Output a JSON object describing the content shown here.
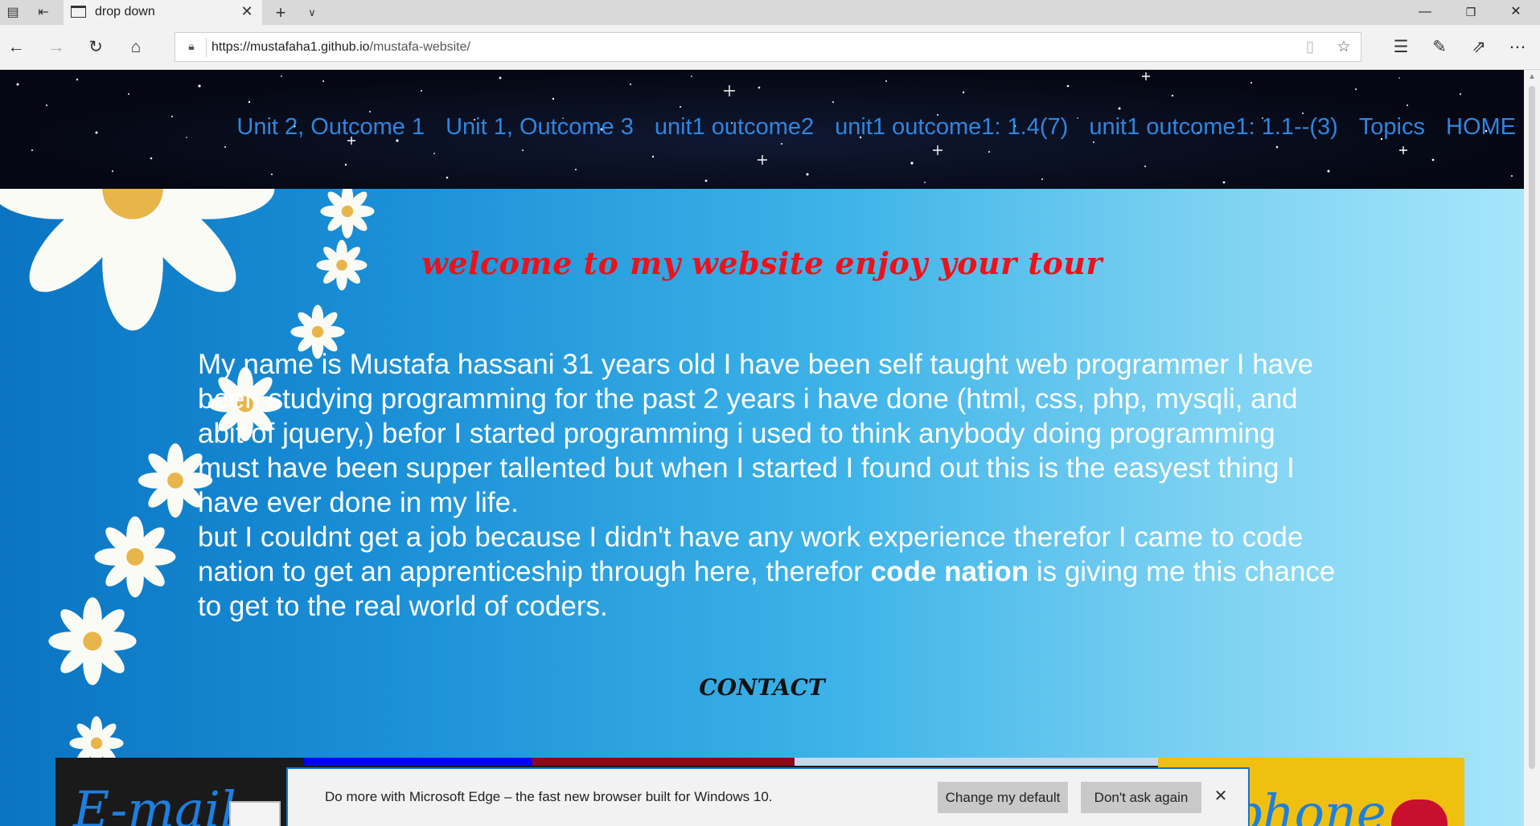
{
  "browser": {
    "tab_title": "drop down",
    "url_host": "https://mustafaha1.github.io",
    "url_path": "/mustafa-website/",
    "icons": {
      "tab_actions": "tab-list-icon",
      "set_aside": "set-aside-tabs-icon",
      "tab_close": "close-icon",
      "new_tab": "plus-icon",
      "tab_menu": "chevron-down-icon",
      "minimize": "minimize-icon",
      "maximize": "restore-icon",
      "close_window": "close-icon",
      "back": "back-arrow-icon",
      "forward": "forward-arrow-icon",
      "refresh": "refresh-icon",
      "home": "home-icon",
      "lock": "lock-icon",
      "reading_view": "book-icon",
      "favorite": "star-icon",
      "favorites_hub": "favorites-hub-icon",
      "notes": "pen-icon",
      "share": "share-icon",
      "more": "more-icon"
    }
  },
  "header": {
    "menu": [
      "Unit 2, Outcome 1",
      "Unit 1, Outcome 3",
      "unit1 outcome2",
      "unit1 outcome1: 1.4(7)",
      "unit1 outcome1: 1.1--(3)",
      "Topics",
      "HOME"
    ]
  },
  "main": {
    "welcome": "welcome to my website enjoy your tour",
    "about_part1": "My name is Mustafa hassani 31 years old I have been self taught web programmer I have been studying programming for the past 2 years i have done (html, css, php, mysqli, and abit of jquery,) befor I started programming i used to think anybody doing programming must have been supper tallented but when I started I found out this is the easyest thing I have ever done in my life.",
    "about_part2": "but I couldnt get a job because I didn't have any work experience therefor I came to code nation to get an apprenticeship through here, therefor ",
    "about_bold": "code nation",
    "about_part3": " is giving me this chance to get to the real world of coders.",
    "contact_heading": "CONTACT",
    "email_label": "E-mail",
    "phone_label": "phone"
  },
  "notification": {
    "text": "Do more with Microsoft Edge – the fast new browser built for Windows 10.",
    "change_default": "Change my default",
    "dont_ask": "Don't ask again"
  },
  "colors": {
    "menu_link": "#2f86e0",
    "welcome_text": "#f0101a",
    "notification_border": "#1b72c9"
  }
}
